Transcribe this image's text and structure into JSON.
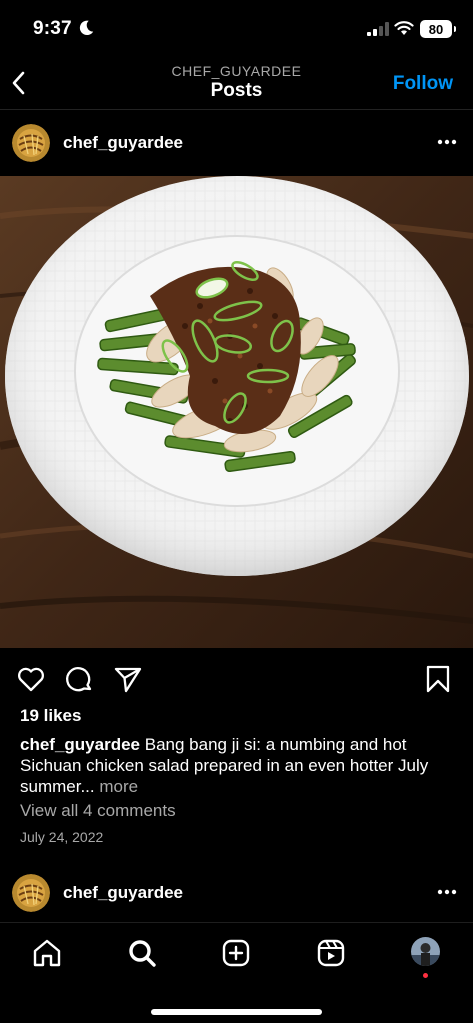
{
  "status_bar": {
    "time": "9:37",
    "battery": "80"
  },
  "nav": {
    "subtitle": "CHEF_GUYARDEE",
    "title": "Posts",
    "follow_label": "Follow"
  },
  "post": {
    "username": "chef_guyardee",
    "likes": "19 likes",
    "caption_user": "chef_guyardee",
    "caption_text": "Bang bang ji si: a numbing and hot Sichuan chicken salad prepared in an even hotter July summer...",
    "caption_more": "more",
    "view_comments": "View all 4 comments",
    "date": "July 24, 2022"
  },
  "next_post": {
    "username": "chef_guyardee"
  },
  "tabs": [
    "home-icon",
    "search-icon",
    "create-icon",
    "reels-icon",
    "profile-avatar"
  ],
  "colors": {
    "accent": "#0095f6",
    "muted": "#a8a8a8",
    "background": "#000000",
    "notification": "#ff3040"
  }
}
